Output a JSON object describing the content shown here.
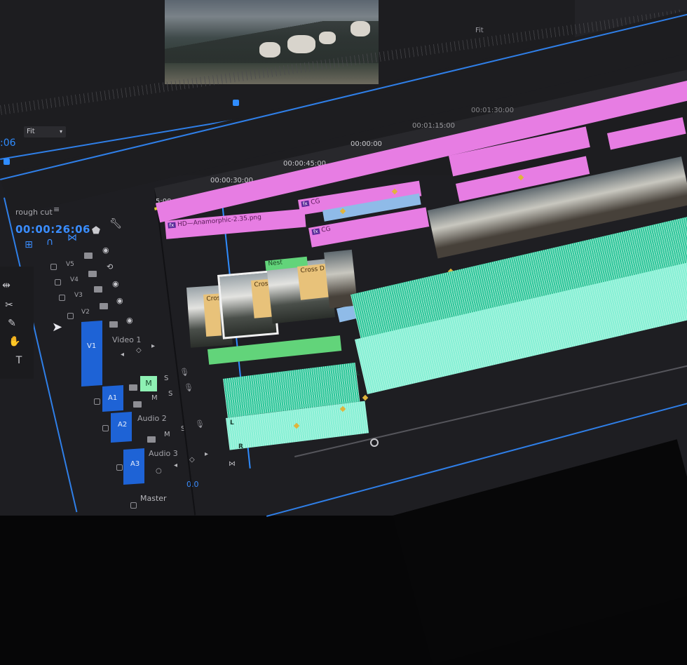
{
  "monitor": {
    "zoom_label": "Fit",
    "timecode_left": ":06",
    "fit_right": "Fit"
  },
  "ruler_labels": [
    "5:00",
    "00:00:30:00",
    "00:00:45:00",
    "00:00:00",
    "00:01:15:00",
    "00:01:30:00"
  ],
  "sequence": {
    "name": "rough cut",
    "menu_icon": "hamburger-icon",
    "timecode": "00:00:26:06"
  },
  "tracks": {
    "v5": "V5",
    "v4": "V4",
    "v3": "V3",
    "v2": "V2",
    "v1_patch": "V1",
    "video1": "Video 1",
    "a1": "A1",
    "a2": "A2",
    "a3": "A3",
    "audio2": "Audio 2",
    "audio3": "Audio 3",
    "m": "M",
    "s": "S",
    "master": "Master",
    "master_value": "0.0"
  },
  "clips": {
    "hd_clip": "HD—Anamorphic-2.35.png",
    "cg1": "CG",
    "cg2": "CG",
    "cross1": "Cros",
    "cross2": "Cross D",
    "nest": "Nest",
    "audio_L": "L",
    "audio_R": "R"
  },
  "colors": {
    "accent": "#2f8cff",
    "graphic_clip": "#e77de3",
    "audio_clip": "#2fc79a",
    "video_clip": "#8fbbe8",
    "transition": "#e8c27a",
    "work_area": "#d9c933"
  }
}
